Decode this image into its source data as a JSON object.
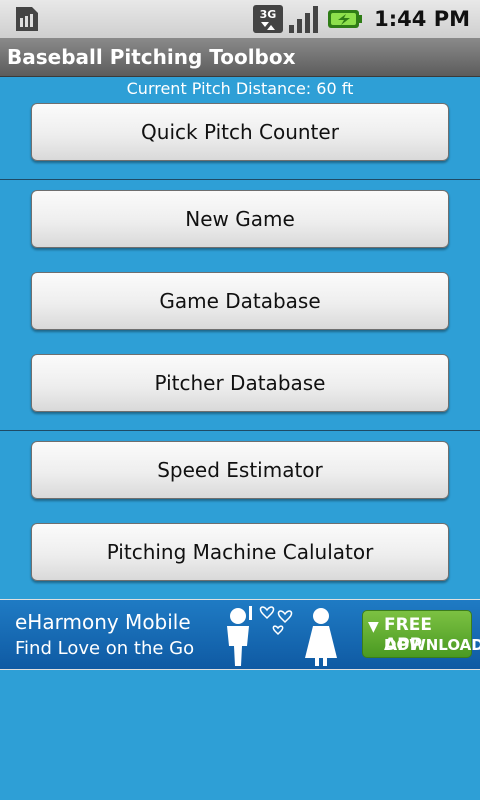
{
  "status_bar": {
    "time": "1:44 PM",
    "network": "3G",
    "icons": [
      "sim-card-icon",
      "network-3g-icon",
      "signal-strength-icon",
      "battery-charging-icon"
    ]
  },
  "app": {
    "title": "Baseball Pitching Toolbox"
  },
  "main": {
    "pitch_distance": "Current Pitch Distance: 60 ft",
    "buttons": [
      {
        "label": "Quick Pitch Counter"
      },
      {
        "label": "New Game"
      },
      {
        "label": "Game Database"
      },
      {
        "label": "Pitcher Database"
      },
      {
        "label": "Speed Estimator"
      },
      {
        "label": "Pitching Machine Calulator"
      }
    ]
  },
  "ad": {
    "title": "eHarmony Mobile",
    "subtitle": "Find Love on the Go",
    "cta_line1": "FREE APP",
    "cta_line2": "DOWNLOAD"
  },
  "colors": {
    "background": "#2e9fd6",
    "titlebar": "#6e6e6e",
    "ad_cta": "#5aa82c"
  }
}
